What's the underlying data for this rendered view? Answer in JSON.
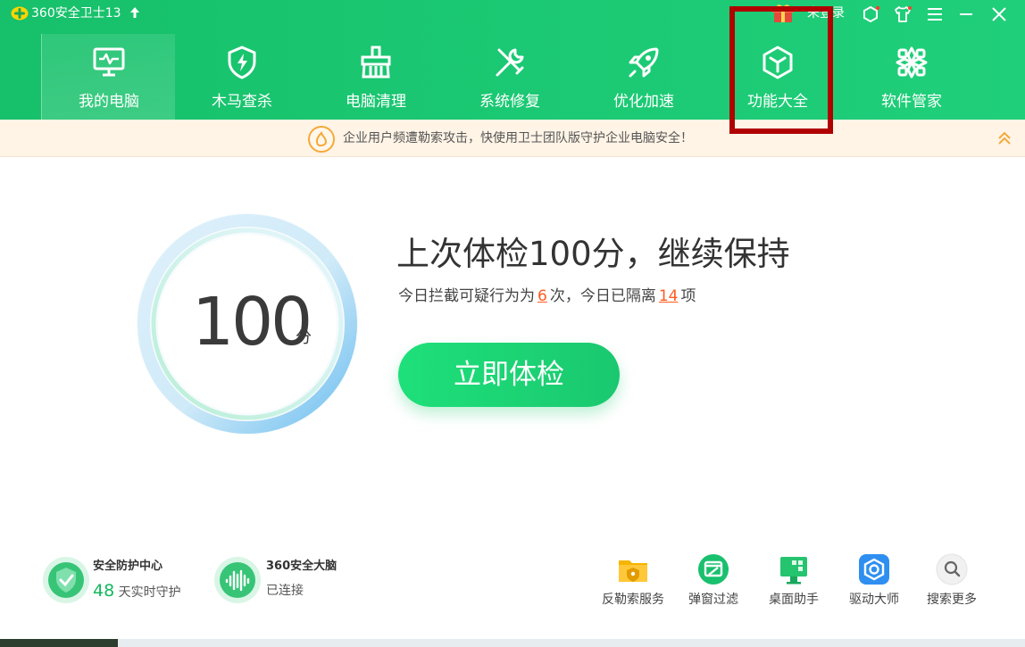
{
  "app": {
    "title": "360安全卫士13",
    "login_label": "未登录"
  },
  "window_controls": [
    "skin-icon",
    "shirt-icon",
    "menu-icon",
    "minimize-icon",
    "close-icon"
  ],
  "nav": [
    {
      "label": "我的电脑",
      "icon": "monitor-icon",
      "active": true
    },
    {
      "label": "木马查杀",
      "icon": "shield-bolt-icon"
    },
    {
      "label": "电脑清理",
      "icon": "broom-icon"
    },
    {
      "label": "系统修复",
      "icon": "wrench-screwdriver-icon"
    },
    {
      "label": "优化加速",
      "icon": "rocket-icon"
    },
    {
      "label": "功能大全",
      "icon": "cube-icon"
    },
    {
      "label": "软件管家",
      "icon": "apps-icon"
    }
  ],
  "notice": {
    "text": "企业用户频遭勒索攻击，快使用卫士团队版守护企业电脑安全！"
  },
  "score": {
    "value": "100",
    "unit": "分"
  },
  "status": {
    "headline": "上次体检100分，继续保持",
    "sub_prefix": "今日拦截可疑行为为",
    "blocked_count": "6",
    "sub_mid": "次，今日已隔离",
    "quarantined_count": "14",
    "sub_suffix": "项"
  },
  "check_button": {
    "label": "立即体检"
  },
  "protection": {
    "title": "安全防护中心",
    "days": "48",
    "days_suffix": "天实时守护"
  },
  "brain": {
    "title": "360安全大脑",
    "status": "已连接"
  },
  "tools": [
    {
      "label": "反勒索服务",
      "icon": "folder-shield-icon"
    },
    {
      "label": "弹窗过滤",
      "icon": "popup-block-icon"
    },
    {
      "label": "桌面助手",
      "icon": "desktop-helper-icon"
    },
    {
      "label": "驱动大师",
      "icon": "driver-icon"
    },
    {
      "label": "搜索更多",
      "icon": "search-icon"
    }
  ],
  "colors": {
    "brand_green": "#1bc873",
    "accent_orange": "#ff5a1f",
    "highlight_red": "#b00000"
  }
}
